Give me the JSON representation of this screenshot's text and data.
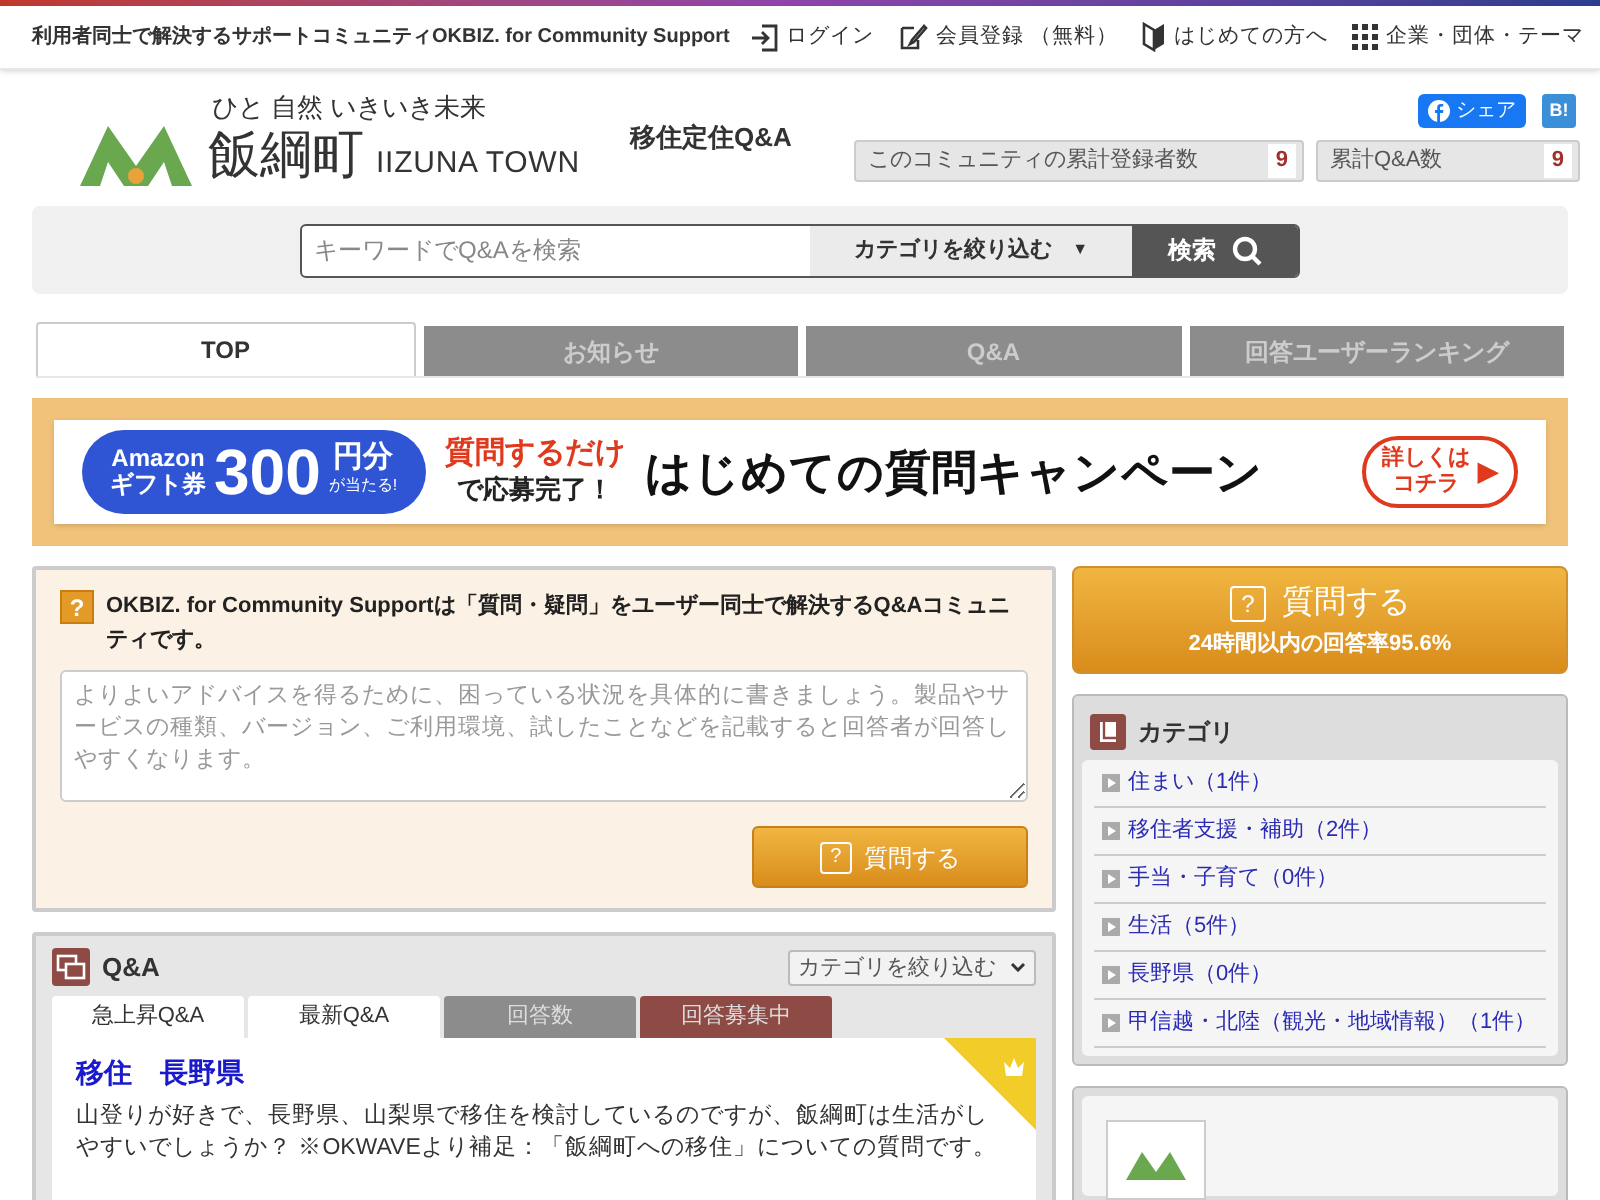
{
  "top_bar": {
    "tagline": "利用者同士で解決するサポートコミュニティOKBIZ. for Community Support",
    "links": [
      {
        "kind": "login",
        "label": "ログイン"
      },
      {
        "kind": "register",
        "label": "会員登録 （無料）"
      },
      {
        "kind": "beginner",
        "label": "はじめての方へ"
      },
      {
        "kind": "grid",
        "label": "企業・団体・テーマ"
      }
    ]
  },
  "header": {
    "logo_slogan": "ひと 自然 いきいき未来",
    "logo_name": "飯綱町",
    "logo_sub": "IIZUNA TOWN",
    "site_title": "移住定住Q&A",
    "share_label": "シェア",
    "hatena_label": "B!",
    "stats": [
      {
        "label": "このコミュニティの累計登録者数",
        "value": "9"
      },
      {
        "label": "累計Q&A数",
        "value": "9"
      }
    ]
  },
  "search": {
    "placeholder": "キーワードでQ&Aを検索",
    "category": "カテゴリを絞り込む",
    "arrow": "▼",
    "button": "検索"
  },
  "tabs": [
    {
      "label": "TOP",
      "selected": true
    },
    {
      "label": "お知らせ",
      "selected": false
    },
    {
      "label": "Q&A",
      "selected": false
    },
    {
      "label": "回答ユーザーランキング",
      "selected": false
    }
  ],
  "banner": {
    "gift_top": "Amazon",
    "gift_bottom": "ギフト券",
    "amount": "300",
    "unit": "円分",
    "win": "が当たる!",
    "lead_red": "質問するだけ",
    "lead_black": "で応募完了！",
    "headline": "はじめての質問キャンペーン",
    "more_top": "詳しくは",
    "more_bottom": "コチラ",
    "more_arrow": "▶"
  },
  "ask_panel": {
    "icon": "?",
    "intro": "OKBIZ. for Community Supportは「質問・疑問」をユーザー同士で解決するQ&Aコミュニティです。",
    "placeholder": "よりよいアドバイスを得るために、困っている状況を具体的に書きましょう。製品やサービスの種類、バージョン、ご利用環境、試したことなどを記載すると回答者が回答しやすくなります。",
    "button_icon": "?",
    "button": "質問する"
  },
  "qa_panel": {
    "title": "Q&A",
    "filter": "カテゴリを絞り込む",
    "tabs": [
      {
        "label": "急上昇Q&A",
        "color": "#ffffff"
      },
      {
        "label": "最新Q&A",
        "color": "#ffffff"
      },
      {
        "label": "回答数",
        "color": "#8c8c8c"
      },
      {
        "label": "回答募集中",
        "color": "#8e4a45"
      }
    ],
    "item": {
      "title": "移住　長野県",
      "body": "山登りが好きで、長野県、山梨県で移住を検討しているのですが、飯綱町は生活がしやすいでしょうか？ ※OKWAVEより補足：「飯綱町への移住」についての質問です。"
    }
  },
  "ask_button": {
    "icon": "?",
    "label": "質問する",
    "sub": "24時間以内の回答率95.6%"
  },
  "categories": {
    "title": "カテゴリ",
    "items": [
      "住まい（1件）",
      "移住者支援・補助（2件）",
      "手当・子育て（0件）",
      "生活（5件）",
      "長野県（0件）",
      "甲信越・北陸（観光・地域情報）（1件）"
    ]
  }
}
